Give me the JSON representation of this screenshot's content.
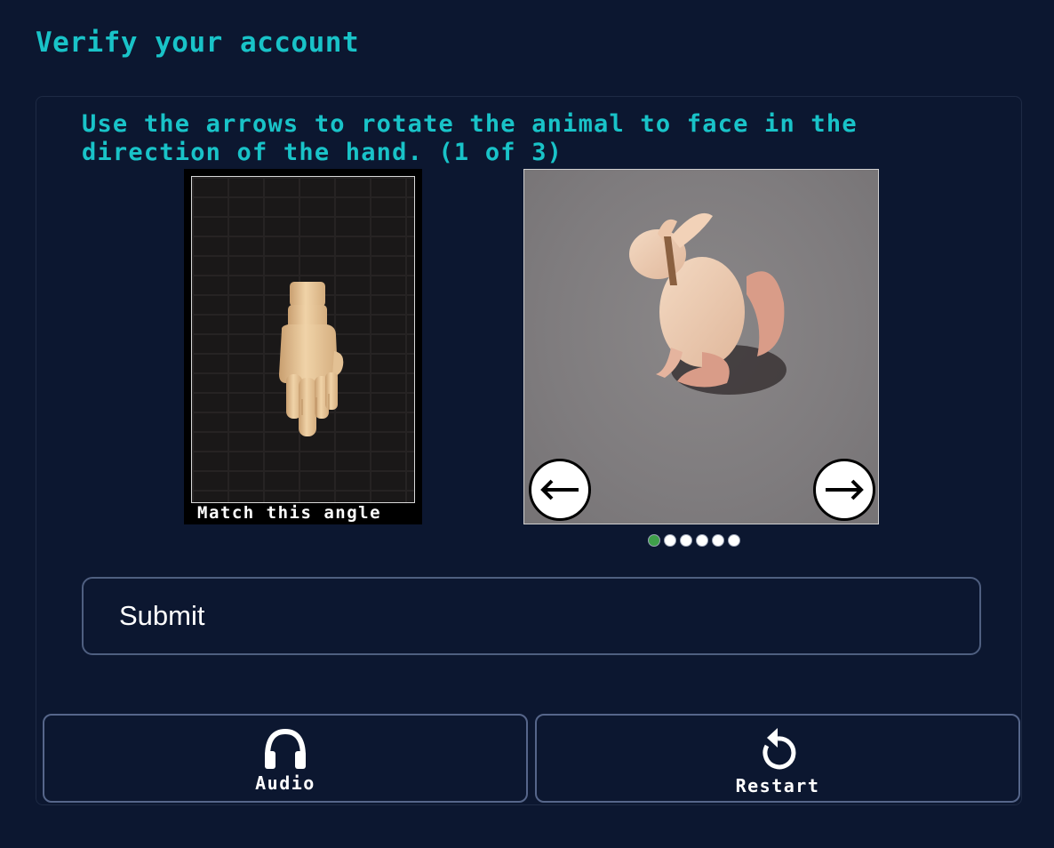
{
  "page": {
    "title": "Verify your account"
  },
  "challenge": {
    "instructions": "Use the arrows to rotate the animal to face in the direction of the hand. (1 of 3)",
    "reference_caption": "Match this angle",
    "reference_image": "hand-pointing-down",
    "animal_image": "kangaroo-like-animal",
    "arrow_left_icon": "arrow-left-icon",
    "arrow_right_icon": "arrow-right-icon",
    "progress_dots": {
      "total": 6,
      "active_index": 0
    }
  },
  "actions": {
    "submit_label": "Submit",
    "audio_label": "Audio",
    "restart_label": "Restart"
  },
  "colors": {
    "background": "#0c1730",
    "accent_text": "#19c3c8",
    "active_dot": "#3fa04a",
    "button_border": "#4f5f80"
  }
}
